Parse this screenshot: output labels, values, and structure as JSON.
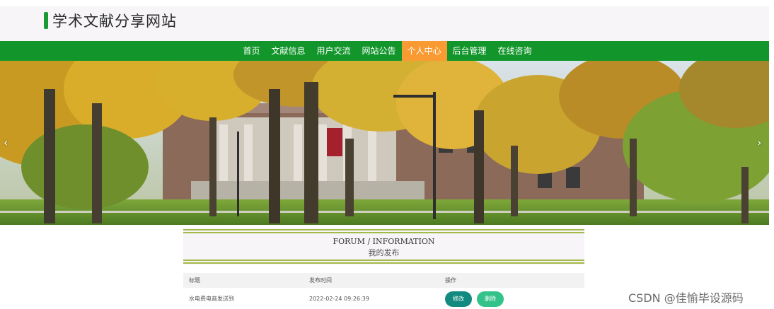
{
  "site": {
    "title": "学术文献分享网站"
  },
  "nav": {
    "items": [
      {
        "label": "首页",
        "active": false
      },
      {
        "label": "文献信息",
        "active": false
      },
      {
        "label": "用户交流",
        "active": false
      },
      {
        "label": "网站公告",
        "active": false
      },
      {
        "label": "个人中心",
        "active": true
      },
      {
        "label": "后台管理",
        "active": false
      },
      {
        "label": "在线咨询",
        "active": false
      }
    ]
  },
  "banner": {
    "prev_arrow": "‹",
    "next_arrow": "›"
  },
  "section": {
    "title_en": "FORUM / INFORMATION",
    "title_cn": "我的发布"
  },
  "table": {
    "headers": [
      "标题",
      "发布时间",
      "操作"
    ],
    "rows": [
      {
        "title": "水电费电商发送到",
        "time": "2022-02-24 09:26:39"
      }
    ],
    "edit_label": "修改",
    "delete_label": "删除"
  },
  "watermark": "CSDN @佳愉毕设源码",
  "colors": {
    "nav_bg": "#12962b",
    "nav_active": "#f99a32",
    "accent_line": "#a3b94a",
    "edit_btn": "#138a7f",
    "delete_btn": "#33c38a"
  }
}
